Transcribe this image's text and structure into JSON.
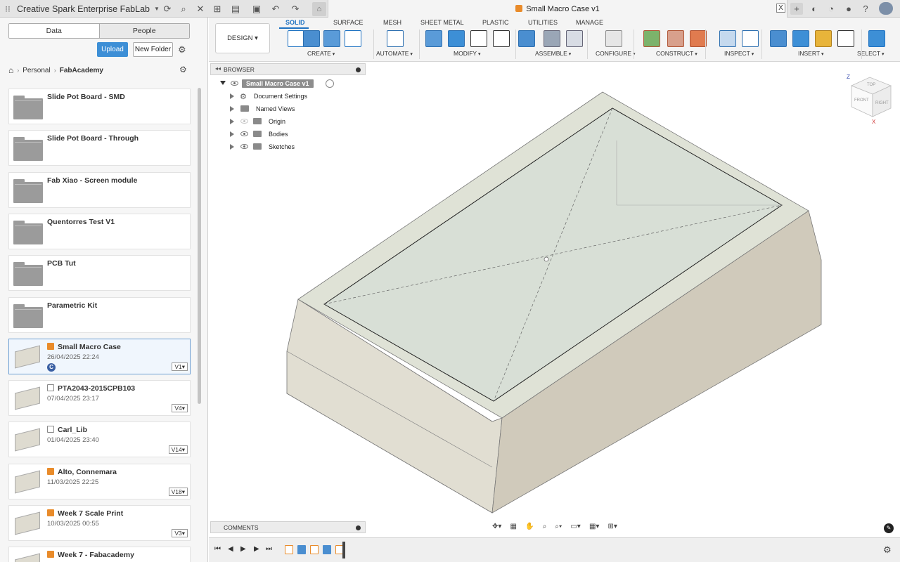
{
  "titlebar": {
    "team": "Creative Spark Enterprise FabLab",
    "doc_title": "Small Macro Case v1",
    "close": "X"
  },
  "data_panel": {
    "tabs": [
      "Data",
      "People"
    ],
    "upload": "Upload",
    "new_folder": "New Folder",
    "breadcrumb": [
      "Personal",
      "FabAcademy"
    ],
    "items": [
      {
        "name": "Slide Pot Board - SMD",
        "type": "folder"
      },
      {
        "name": "Slide Pot Board - Through",
        "type": "folder"
      },
      {
        "name": "Fab Xiao - Screen module",
        "type": "folder"
      },
      {
        "name": "Quentorres Test V1",
        "type": "folder"
      },
      {
        "name": "PCB Tut",
        "type": "folder"
      },
      {
        "name": "Parametric Kit",
        "type": "folder"
      },
      {
        "name": "Small Macro Case",
        "type": "design",
        "date": "26/04/2025 22:24",
        "version": "V1",
        "badge": "C",
        "selected": true
      },
      {
        "name": "PTA2043-2015CPB103",
        "type": "elec",
        "date": "07/04/2025 23:17",
        "version": "V4"
      },
      {
        "name": "Carl_Lib",
        "type": "elec",
        "date": "01/04/2025 23:40",
        "version": "V14"
      },
      {
        "name": "Alto, Connemara",
        "type": "design",
        "date": "11/03/2025 22:25",
        "version": "V18"
      },
      {
        "name": "Week 7 Scale Print",
        "type": "design",
        "date": "10/03/2025 00:55",
        "version": "V3"
      },
      {
        "name": "Week 7 - Fabacademy",
        "type": "design"
      }
    ]
  },
  "toolbar": {
    "workspace": "DESIGN",
    "tabs": [
      "SOLID",
      "SURFACE",
      "MESH",
      "SHEET METAL",
      "PLASTIC",
      "UTILITIES",
      "MANAGE"
    ],
    "groups": [
      "CREATE",
      "AUTOMATE",
      "MODIFY",
      "ASSEMBLE",
      "CONFIGURE",
      "CONSTRUCT",
      "INSPECT",
      "INSERT",
      "SELECT"
    ]
  },
  "browser": {
    "title": "BROWSER",
    "root": "Small Macro Case v1",
    "nodes": [
      "Document Settings",
      "Named Views",
      "Origin",
      "Bodies",
      "Sketches"
    ]
  },
  "viewcube": {
    "top": "TOP",
    "front": "FRONT",
    "right": "RIGHT",
    "z": "Z",
    "x": "X"
  },
  "comments": {
    "title": "COMMENTS"
  },
  "colors": {
    "accent": "#1e72c2",
    "upload": "#3d8fd6",
    "design_icon": "#e98b2a"
  }
}
